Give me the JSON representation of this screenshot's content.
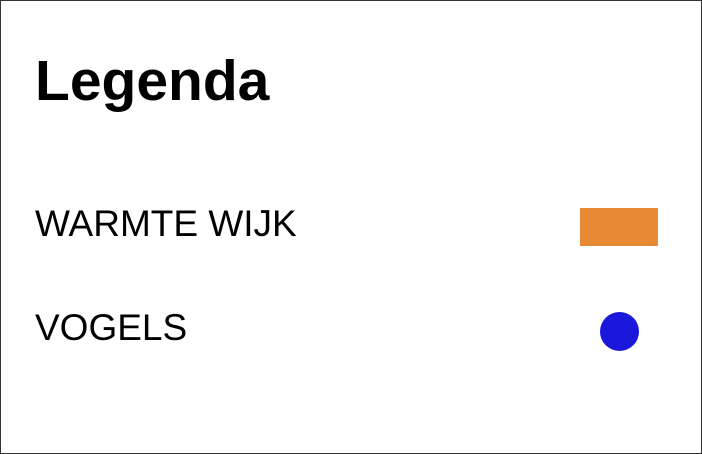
{
  "legend": {
    "title": "Legenda",
    "items": [
      {
        "label": "WARMTE WIJK",
        "symbol": "rectangle",
        "color": "#e88a35"
      },
      {
        "label": "VOGELS",
        "symbol": "circle",
        "color": "#1b18dc"
      }
    ]
  }
}
